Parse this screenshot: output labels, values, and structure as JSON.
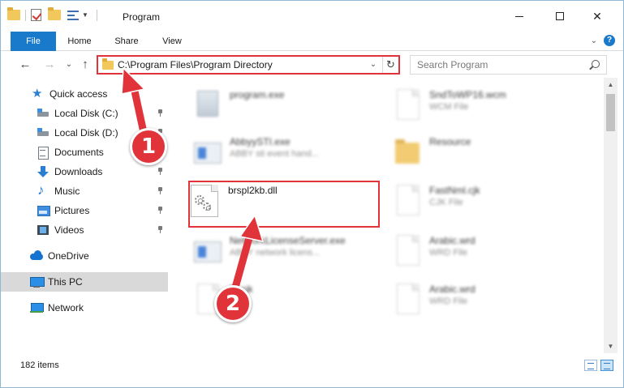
{
  "window": {
    "title": "Program",
    "controls": {
      "minimize": "",
      "maximize": "",
      "close": "✕"
    }
  },
  "ribbon": {
    "tabs": [
      "File",
      "Home",
      "Share",
      "View"
    ],
    "expand_icon": "chevron-down-icon",
    "help_label": "?"
  },
  "address": {
    "path": "C:\\Program Files\\Program Directory",
    "dropdown": "⌄",
    "refresh": "↻"
  },
  "search": {
    "placeholder": "Search Program"
  },
  "nav": {
    "back": "←",
    "forward": "→",
    "recent": "⌄",
    "up": "↑"
  },
  "sidebar": {
    "items": [
      {
        "label": "Quick access",
        "icon": "star-icon",
        "pinned": false
      },
      {
        "label": "Local Disk (C:)",
        "icon": "disk-icon",
        "pinned": true
      },
      {
        "label": "Local Disk (D:)",
        "icon": "disk-icon",
        "pinned": true
      },
      {
        "label": "Documents",
        "icon": "documents-icon",
        "pinned": true
      },
      {
        "label": "Downloads",
        "icon": "downloads-icon",
        "pinned": true
      },
      {
        "label": "Music",
        "icon": "music-icon",
        "pinned": true
      },
      {
        "label": "Pictures",
        "icon": "pictures-icon",
        "pinned": true
      },
      {
        "label": "Videos",
        "icon": "videos-icon",
        "pinned": true
      },
      {
        "label": "OneDrive",
        "icon": "onedrive-icon",
        "pinned": false
      },
      {
        "label": "This PC",
        "icon": "this-pc-icon",
        "pinned": false,
        "selected": true
      },
      {
        "label": "Network",
        "icon": "network-icon",
        "pinned": false
      }
    ]
  },
  "files": [
    {
      "name": "program.exe",
      "type": "",
      "icon": "exe-icon",
      "blurred": true
    },
    {
      "name": "SndToWP16.wcm",
      "type": "WCM File",
      "icon": "file-icon",
      "blurred": true
    },
    {
      "name": "AbbyySTI.exe",
      "type": "ABBY sti event hand...",
      "icon": "app-icon",
      "blurred": true
    },
    {
      "name": "Resource",
      "type": "",
      "icon": "folder-icon",
      "blurred": true
    },
    {
      "name": "brspl2kb.dll",
      "type": "",
      "icon": "dll-icon",
      "blurred": false
    },
    {
      "name": "FastNml.cjk",
      "type": "CJK File",
      "icon": "file-icon",
      "blurred": true
    },
    {
      "name": "NetworkLicenseServer.exe",
      "type": "ABBY network licens...",
      "icon": "app-icon",
      "blurred": true
    },
    {
      "name": "Arabic.wrd",
      "type": "WRD File",
      "icon": "file-icon",
      "blurred": true
    },
    {
      "name": "Bl.cjk",
      "type": "File",
      "icon": "file-icon",
      "blurred": true
    },
    {
      "name": "Arabic.wrd",
      "type": "WRD File",
      "icon": "file-icon",
      "blurred": true
    }
  ],
  "status": {
    "items_count": "182 items"
  },
  "annotations": {
    "step1": "1",
    "step2": "2",
    "color": "#e0343a"
  }
}
